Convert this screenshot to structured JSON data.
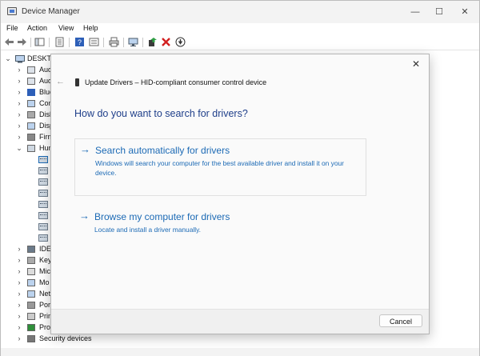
{
  "window": {
    "title": "Device Manager",
    "minimize": "—",
    "maximize": "☐",
    "close": "✕"
  },
  "menu": [
    "File",
    "Action",
    "View",
    "Help"
  ],
  "tree": {
    "root_label": "DESKTO",
    "categories": [
      {
        "label": "Aud",
        "icon": "audio-inputs-icon",
        "expanded": false
      },
      {
        "label": "Aud",
        "icon": "audio-icon",
        "expanded": false
      },
      {
        "label": "Blue",
        "icon": "bluetooth-icon",
        "expanded": false
      },
      {
        "label": "Con",
        "icon": "computer-icon",
        "expanded": false
      },
      {
        "label": "Disk",
        "icon": "disk-drive-icon",
        "expanded": false
      },
      {
        "label": "Disp",
        "icon": "display-adapter-icon",
        "expanded": false
      },
      {
        "label": "Firm",
        "icon": "firmware-icon",
        "expanded": false
      },
      {
        "label": "Hun",
        "icon": "hid-icon",
        "expanded": true
      }
    ],
    "hid_children_count": 8,
    "more_categories": [
      {
        "label": "IDE",
        "icon": "ide-controller-icon"
      },
      {
        "label": "Key",
        "icon": "keyboard-icon"
      },
      {
        "label": "Mic",
        "icon": "mouse-icon"
      },
      {
        "label": "Mo",
        "icon": "monitor-icon"
      },
      {
        "label": "Net",
        "icon": "network-icon"
      },
      {
        "label": "Por",
        "icon": "ports-icon"
      },
      {
        "label": "Prin",
        "icon": "printer-icon"
      },
      {
        "label": "Pro",
        "icon": "processor-icon"
      },
      {
        "label": "Security devices",
        "icon": "security-device-icon"
      }
    ]
  },
  "dialog": {
    "close": "✕",
    "back": "←",
    "title": "Update Drivers – HID-compliant consumer control device",
    "question": "How do you want to search for drivers?",
    "option1": {
      "arrow": "→",
      "heading": "Search automatically for drivers",
      "description": "Windows will search your computer for the best available driver and install it on your device."
    },
    "option2": {
      "arrow": "→",
      "heading": "Browse my computer for drivers",
      "description": "Locate and install a driver manually."
    },
    "cancel": "Cancel"
  },
  "colors": {
    "link": "#1c6ab5",
    "heading": "#1f3f8a"
  }
}
